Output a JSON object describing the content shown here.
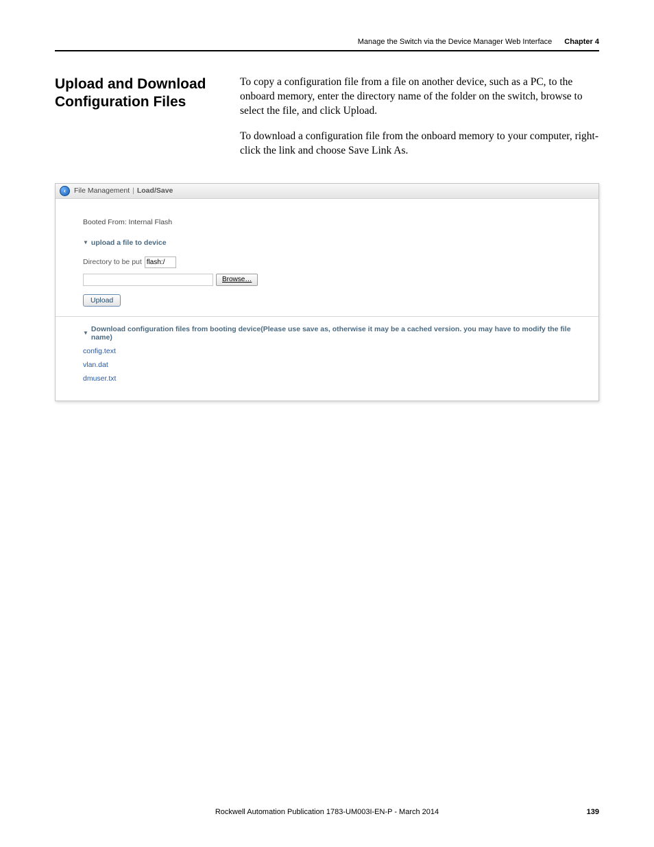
{
  "header": {
    "chapterTitle": "Manage the Switch via the Device Manager Web Interface",
    "chapterLabel": "Chapter 4"
  },
  "section": {
    "heading": "Upload and Download Configuration Files",
    "para1": "To copy a configuration file from a file on another device, such as a PC, to the onboard memory, enter the directory name of the folder on the switch, browse to select the file, and click Upload.",
    "para2": "To download a configuration file from the onboard memory to your computer, right-click the link and choose Save Link As."
  },
  "app": {
    "backGlyph": "‹",
    "breadcrumbParent": "File Management",
    "breadcrumbSep": "|",
    "breadcrumbCurrent": "Load/Save",
    "bootedLabel": "Booted From: Internal Flash",
    "uploadHeading": "upload a file to device",
    "dirLabel": "Directory to be put",
    "dirValue": "flash:/",
    "browseLabel": "Browse…",
    "uploadLabel": "Upload",
    "downloadHeading": "Download configuration files from booting device(Please use save as, otherwise it may be a cached version. you may have to modify the file name)",
    "files": {
      "f1": "config.text",
      "f2": "vlan.dat",
      "f3": "dmuser.txt"
    },
    "triangle": "▼"
  },
  "footer": {
    "text": "Rockwell Automation Publication 1783-UM003I-EN-P - March 2014",
    "pageNum": "139"
  }
}
